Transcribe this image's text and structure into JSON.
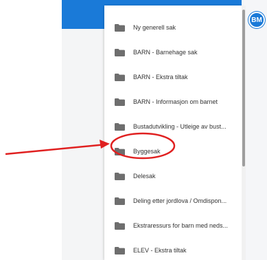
{
  "header": {
    "avatar_initials": "BM"
  },
  "dropdown": {
    "items": [
      {
        "label": "Ny generell sak"
      },
      {
        "label": "BARN - Barnehage sak"
      },
      {
        "label": "BARN - Ekstra tiltak"
      },
      {
        "label": "BARN - Informasjon om barnet"
      },
      {
        "label": "Bustadutvikling - Utleige av bust..."
      },
      {
        "label": "Byggesak"
      },
      {
        "label": "Delesak"
      },
      {
        "label": "Deling etter jordlova / Omdispon..."
      },
      {
        "label": "Ekstraressurs for barn med neds..."
      },
      {
        "label": "ELEV - Ekstra tiltak"
      }
    ]
  },
  "icons": {
    "item_icon": "folder-icon",
    "avatar": "user-avatar"
  },
  "colors": {
    "header_blue": "#1a7ad8",
    "folder_icon": "#6e6e6e",
    "annotation_red": "#e02020",
    "item_text": "#333333"
  }
}
